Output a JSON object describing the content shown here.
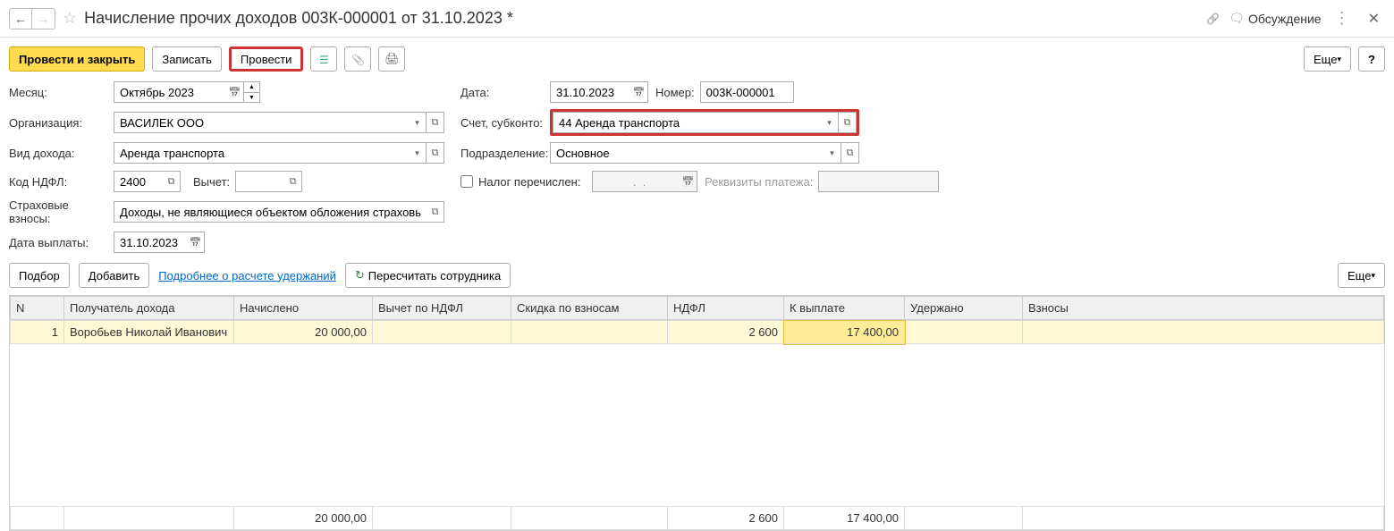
{
  "header": {
    "title": "Начисление прочих доходов 003К-000001 от 31.10.2023 *",
    "discuss_label": "Обсуждение"
  },
  "toolbar": {
    "post_and_close": "Провести и закрыть",
    "save": "Записать",
    "post": "Провести",
    "more": "Еще",
    "help": "?"
  },
  "form": {
    "month_label": "Месяц:",
    "month_value": "Октябрь 2023",
    "date_label": "Дата:",
    "date_value": "31.10.2023",
    "number_label": "Номер:",
    "number_value": "003К-000001",
    "org_label": "Организация:",
    "org_value": "ВАСИЛЕК ООО",
    "account_label": "Счет, субконто:",
    "account_value": "44 Аренда транспорта",
    "income_type_label": "Вид дохода:",
    "income_type_value": "Аренда транспорта",
    "department_label": "Подразделение:",
    "department_value": "Основное",
    "ndfl_code_label": "Код НДФЛ:",
    "ndfl_code_value": "2400",
    "deduction_label": "Вычет:",
    "deduction_value": "",
    "tax_transferred_label": "Налог перечислен:",
    "tax_date_value": "  .  .",
    "payment_details_label": "Реквизиты платежа:",
    "payment_details_value": "",
    "insurance_label": "Страховые взносы:",
    "insurance_value": "Доходы, не являющиеся объектом обложения страховыми вз",
    "payout_date_label": "Дата выплаты:",
    "payout_date_value": "31.10.2023"
  },
  "actions": {
    "select": "Подбор",
    "add": "Добавить",
    "more_about_deductions": "Подробнее о расчете удержаний",
    "recalc": "Пересчитать сотрудника",
    "more": "Еще"
  },
  "table": {
    "headers": {
      "n": "N",
      "recipient": "Получатель дохода",
      "accrued": "Начислено",
      "ndfl_deduction": "Вычет по НДФЛ",
      "insurance_discount": "Скидка по взносам",
      "ndfl": "НДФЛ",
      "to_pay": "К выплате",
      "withheld": "Удержано",
      "contributions": "Взносы"
    },
    "rows": [
      {
        "n": "1",
        "recipient": "Воробьев Николай Иванович",
        "accrued": "20 000,00",
        "ndfl_deduction": "",
        "insurance_discount": "",
        "ndfl": "2 600",
        "to_pay": "17 400,00",
        "withheld": "",
        "contributions": ""
      }
    ],
    "totals": {
      "accrued": "20 000,00",
      "ndfl": "2 600",
      "to_pay": "17 400,00"
    }
  }
}
